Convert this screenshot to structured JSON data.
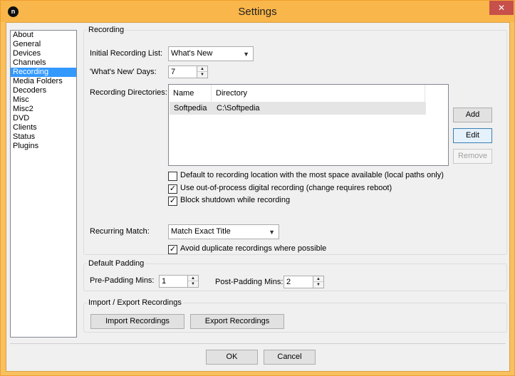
{
  "window": {
    "title": "Settings",
    "close_glyph": "✕",
    "app_icon_letter": "n"
  },
  "nav": {
    "items": [
      "About",
      "General",
      "Devices",
      "Channels",
      "Recording",
      "Media Folders",
      "Decoders",
      "Misc",
      "Misc2",
      "DVD",
      "Clients",
      "Status",
      "Plugins"
    ],
    "selected": "Recording"
  },
  "recording": {
    "legend": "Recording",
    "initial_list_label": "Initial Recording List:",
    "initial_list_value": "What's New",
    "whats_new_days_label": "'What's New' Days:",
    "whats_new_days_value": "7",
    "directories_label": "Recording Directories:",
    "dir_columns": [
      "Name",
      "Directory"
    ],
    "dir_rows": [
      {
        "name": "Softpedia",
        "directory": "C:\\Softpedia"
      }
    ],
    "add_label": "Add",
    "edit_label": "Edit",
    "remove_label": "Remove",
    "opt_default_location": "Default to recording location with the most space available (local paths only)",
    "opt_default_location_checked": false,
    "opt_out_of_process": "Use out-of-process digital recording (change requires reboot)",
    "opt_out_of_process_checked": true,
    "opt_block_shutdown": "Block shutdown while recording",
    "opt_block_shutdown_checked": true,
    "recurring_match_label": "Recurring Match:",
    "recurring_match_value": "Match Exact Title",
    "opt_avoid_duplicates": "Avoid duplicate recordings where possible",
    "opt_avoid_duplicates_checked": true
  },
  "padding": {
    "legend": "Default Padding",
    "pre_label": "Pre-Padding Mins:",
    "pre_value": "1",
    "post_label": "Post-Padding Mins:",
    "post_value": "2"
  },
  "import_export": {
    "legend": "Import / Export Recordings",
    "import_label": "Import Recordings",
    "export_label": "Export Recordings"
  },
  "footer": {
    "ok_label": "OK",
    "cancel_label": "Cancel"
  },
  "colors": {
    "titlebar": "#f9b64a",
    "selection": "#3399ff",
    "close": "#c7504a"
  },
  "icons": {
    "check": "check-icon",
    "dropdown": "chevron-down-icon",
    "spin_up": "triangle-up-icon",
    "spin_down": "triangle-down-icon"
  }
}
